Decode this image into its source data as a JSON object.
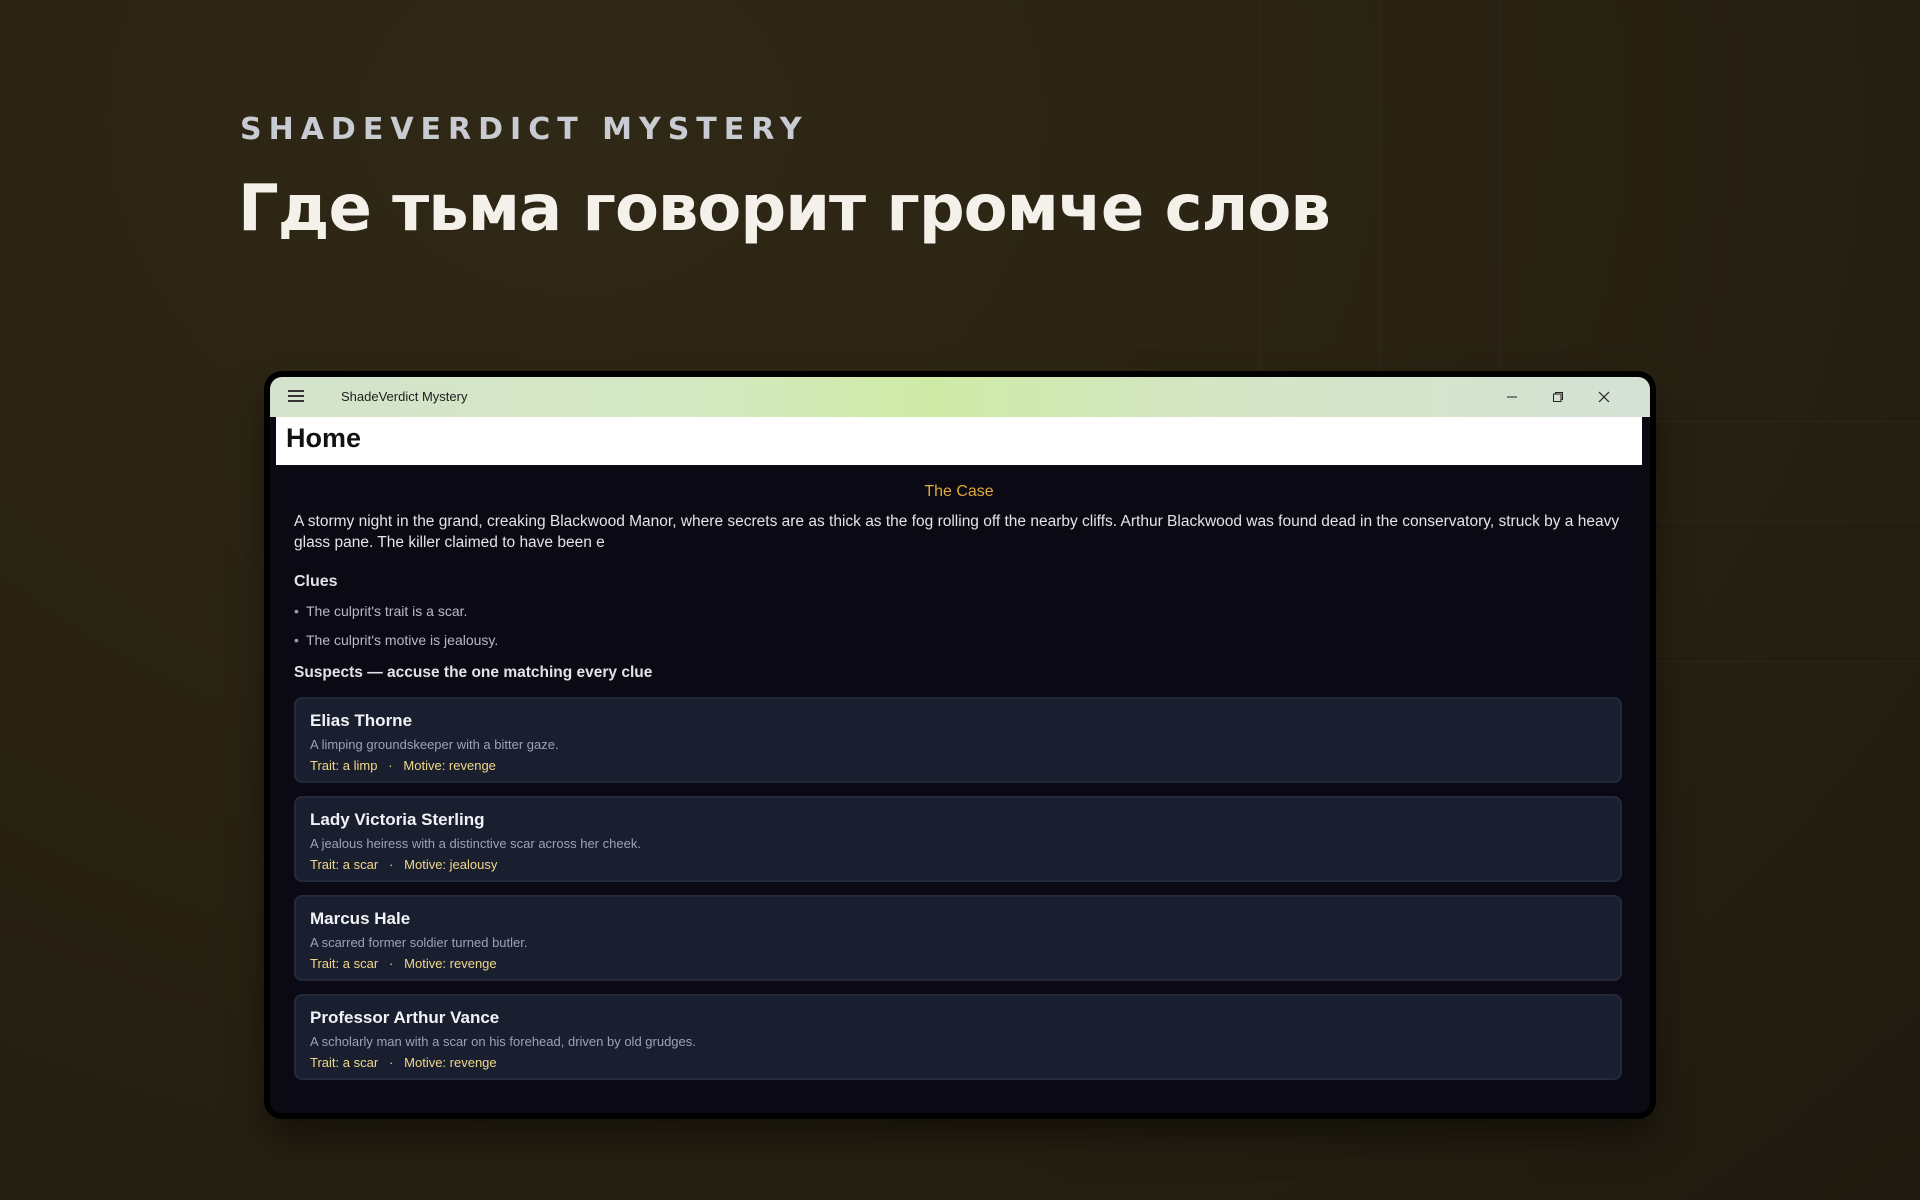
{
  "hero": {
    "eyebrow": "SHADEVERDICT MYSTERY",
    "headline": "Где тьма говорит громче слов"
  },
  "window": {
    "app_title": "ShadeVerdict Mystery",
    "icons": {
      "menu": "hamburger-icon",
      "minimize": "minimize-icon",
      "restore": "restore-icon",
      "close": "close-icon"
    }
  },
  "page": {
    "title": "Home"
  },
  "case": {
    "title": "The Case",
    "text": "A stormy night in the grand, creaking Blackwood Manor, where secrets are as thick as the fog rolling off the nearby cliffs. Arthur Blackwood was found dead in the conservatory, struck by a heavy glass pane. The killer claimed to have been e"
  },
  "clues": {
    "heading": "Clues",
    "items": [
      "The culprit's trait is a scar.",
      "The culprit's motive is jealousy."
    ]
  },
  "suspects": {
    "heading": "Suspects — accuse the one matching every clue",
    "items": [
      {
        "name": "Elias Thorne",
        "description": "A limping groundskeeper with a bitter gaze.",
        "meta": "Trait: a limp   ·   Motive: revenge"
      },
      {
        "name": "Lady Victoria Sterling",
        "description": "A jealous heiress with a distinctive scar across her cheek.",
        "meta": "Trait: a scar   ·   Motive: jealousy"
      },
      {
        "name": "Marcus Hale",
        "description": "A scarred former soldier turned butler.",
        "meta": "Trait: a scar   ·   Motive: revenge"
      },
      {
        "name": "Professor Arthur Vance",
        "description": "A scholarly man with a scar on his forehead, driven by old grudges.",
        "meta": "Trait: a scar   ·   Motive: revenge"
      }
    ]
  },
  "colors": {
    "background": "#2b2414",
    "accent": "#e0a838",
    "card": "#1a1f2f",
    "meta_text": "#f0d88a"
  }
}
